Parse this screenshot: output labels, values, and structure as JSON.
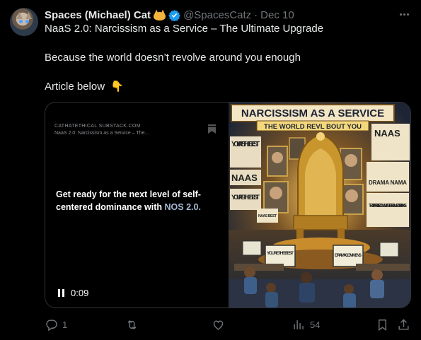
{
  "author": {
    "name": "Spaces (Michael) Cat",
    "handle": "@SpacesCatz",
    "separator": "·",
    "date": "Dec 10"
  },
  "tweet": {
    "line1": "NaaS 2.0: Narcissism as a Service – The Ultimate Upgrade",
    "line2": "Because the world doesn’t revolve around you enough",
    "line3": "Article below",
    "line3_emoji": "👇"
  },
  "card": {
    "domain": "CATHATETHICAL.SUBSTACK.COM",
    "title": "NaaS 2.0: Narcissism as a Service – The...",
    "hook_prefix": "Get ready for the next level of self-centered dominance with ",
    "hook_accent": "NOS 2.0.",
    "video_time": "0:09",
    "image_banner_title": "NARCISSISM AS A SERVICE",
    "image_banner_subtitle": "THE WORLD REVL BOUT YOU",
    "image_sign_youre_best": "YOU'RE THE BEST",
    "image_sign_naas": "NAAS",
    "image_sign_drama": "DRAMA NAMA",
    "image_sign_trak": "TRAK PRAISE COMMENTS DRAMS CAPPIGNS",
    "image_sign_small": "NAAS BEST",
    "image_screen1": "YOU'RE THE BEST",
    "image_screen2": "DRAMA COMMENS"
  },
  "actions": {
    "replies": "1",
    "reposts": "",
    "likes": "",
    "views": "54"
  },
  "colors": {
    "accent_blue": "#1d9bf0",
    "muted": "#71767b",
    "text": "#e7e9ea"
  },
  "icons": [
    "verified-badge-icon",
    "more-icon",
    "bookmark-icon",
    "pause-icon",
    "reply-icon",
    "repost-icon",
    "like-icon",
    "views-icon",
    "share-icon"
  ]
}
